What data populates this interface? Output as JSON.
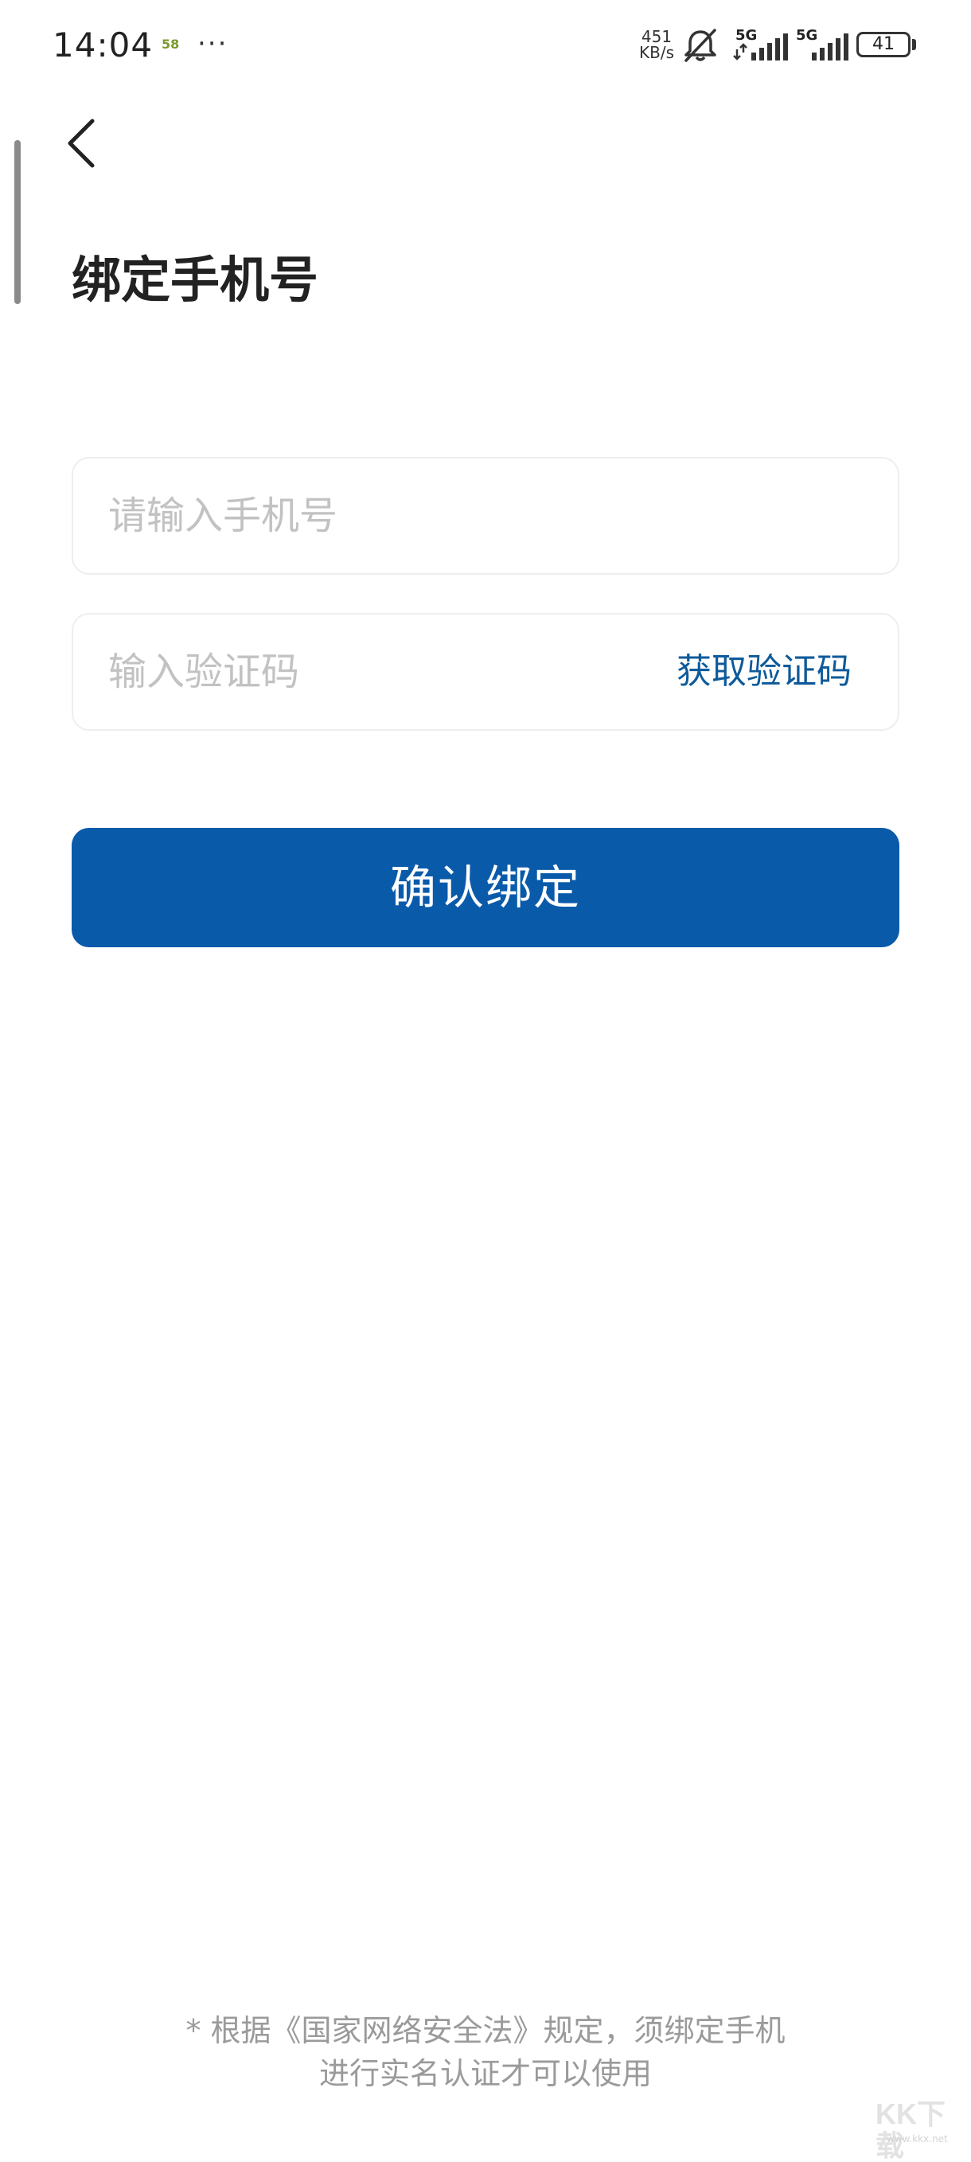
{
  "status_bar": {
    "time": "14:04",
    "app_icon_text": "58",
    "more_dots": "···",
    "net_speed_value": "451",
    "net_speed_unit": "KB/s",
    "signal1_label": "5G",
    "signal2_label": "5G",
    "battery_level": "41",
    "icons": [
      "bell-muted-icon",
      "signal-icon",
      "signal-icon",
      "battery-icon"
    ]
  },
  "header": {
    "back_icon": "chevron-left-icon",
    "title": "绑定手机号"
  },
  "form": {
    "phone_placeholder": "请输入手机号",
    "phone_value": "",
    "code_placeholder": "输入验证码",
    "code_value": "",
    "get_code_label": "获取验证码",
    "confirm_label": "确认绑定"
  },
  "footer": {
    "note_line1": "* 根据《国家网络安全法》规定，须绑定手机",
    "note_line2": "进行实名认证才可以使用"
  },
  "watermark": {
    "main": "KK下载",
    "sub": "www.kkx.net"
  },
  "colors": {
    "accent": "#0a5aaa",
    "link": "#0e5a9a",
    "placeholder": "#c2c2c2",
    "footer_text": "#9a9a9a"
  }
}
